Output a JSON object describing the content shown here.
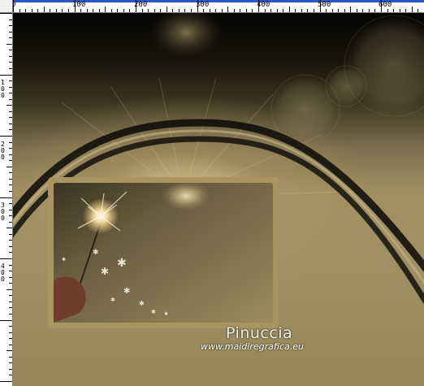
{
  "ruler": {
    "top_labels": [
      "0",
      "100",
      "200",
      "300",
      "400",
      "500",
      "600"
    ],
    "left_labels": [
      "1",
      "0",
      "0",
      "2",
      "0",
      "0",
      "3",
      "0",
      "0",
      "4",
      "0",
      "0"
    ]
  },
  "canvas": {
    "watermark_name": "Pinuccia",
    "watermark_url": "www.maidiregrafica.eu"
  },
  "colors": {
    "frame_gold": "#a89560",
    "ruler_blue": "#2b57c9"
  }
}
